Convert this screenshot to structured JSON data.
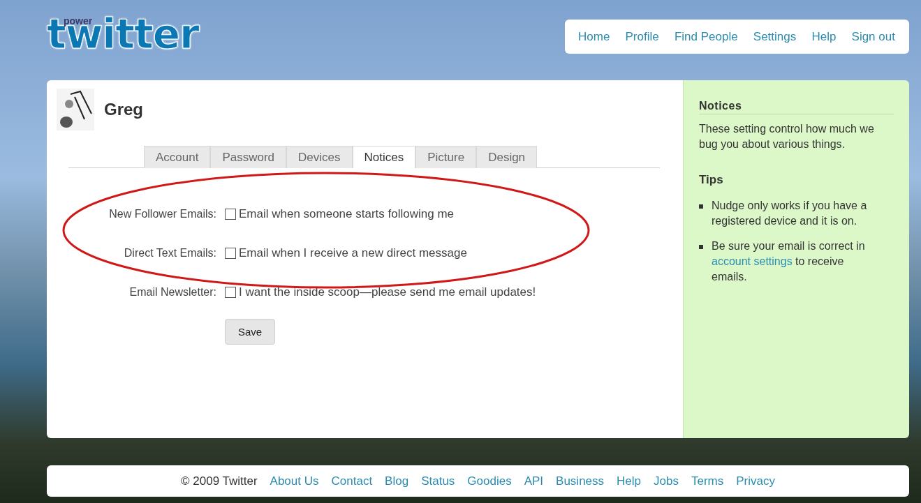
{
  "logo": {
    "badge": "power",
    "wordmark": "twitter"
  },
  "nav": [
    "Home",
    "Profile",
    "Find People",
    "Settings",
    "Help",
    "Sign out"
  ],
  "profile": {
    "name": "Greg"
  },
  "tabs": [
    {
      "label": "Account",
      "selected": false
    },
    {
      "label": "Password",
      "selected": false
    },
    {
      "label": "Devices",
      "selected": false
    },
    {
      "label": "Notices",
      "selected": true
    },
    {
      "label": "Picture",
      "selected": false
    },
    {
      "label": "Design",
      "selected": false
    }
  ],
  "settings": [
    {
      "label": "New Follower Emails:",
      "option": "Email when someone starts following me",
      "checked": false
    },
    {
      "label": "Direct Text Emails:",
      "option": "Email when I receive a new direct message",
      "checked": false
    },
    {
      "label": "Email Newsletter:",
      "option": "I want the inside scoop—please send me email updates!",
      "checked": false
    }
  ],
  "save_button": "Save",
  "sidebar": {
    "title": "Notices",
    "description": "These setting control how much we bug you about various things.",
    "tips_heading": "Tips",
    "tips": [
      {
        "before": "Nudge only works if you have a registered device and it is on."
      },
      {
        "before": "Be sure your email is correct in ",
        "link": "account settings",
        "after": " to receive emails."
      }
    ]
  },
  "footer": {
    "copyright": "© 2009 Twitter",
    "links": [
      "About Us",
      "Contact",
      "Blog",
      "Status",
      "Goodies",
      "API",
      "Business",
      "Help",
      "Jobs",
      "Terms",
      "Privacy"
    ]
  }
}
